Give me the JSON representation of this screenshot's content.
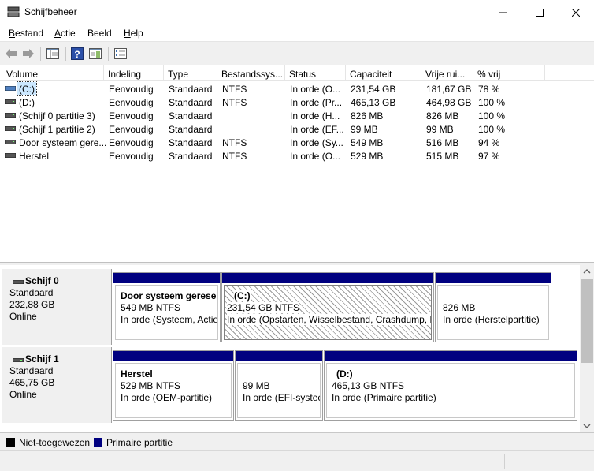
{
  "window": {
    "title": "Schijfbeheer"
  },
  "menu": {
    "items": [
      {
        "label": "Bestand",
        "underline": "B",
        "rest": "estand"
      },
      {
        "label": "Actie",
        "underline": "A",
        "rest": "ctie"
      },
      {
        "label": "Beeld",
        "underline": "",
        "rest": "Beeld"
      },
      {
        "label": "Help",
        "underline": "H",
        "rest": "elp"
      }
    ]
  },
  "list": {
    "columns": [
      "Volume",
      "Indeling",
      "Type",
      "Bestandssys...",
      "Status",
      "Capaciteit",
      "Vrije rui...",
      "% vrij"
    ],
    "rows": [
      {
        "volume": "(C:)",
        "indeling": "Eenvoudig",
        "type": "Standaard",
        "fs": "NTFS",
        "status": "In orde (O...",
        "capaciteit": "231,54 GB",
        "vrij": "181,67 GB",
        "pct": "78 %"
      },
      {
        "volume": "(D:)",
        "indeling": "Eenvoudig",
        "type": "Standaard",
        "fs": "NTFS",
        "status": "In orde (Pr...",
        "capaciteit": "465,13 GB",
        "vrij": "464,98 GB",
        "pct": "100 %"
      },
      {
        "volume": "(Schijf 0 partitie 3)",
        "indeling": "Eenvoudig",
        "type": "Standaard",
        "fs": "",
        "status": "In orde (H...",
        "capaciteit": "826 MB",
        "vrij": "826 MB",
        "pct": "100 %"
      },
      {
        "volume": "(Schijf 1 partitie 2)",
        "indeling": "Eenvoudig",
        "type": "Standaard",
        "fs": "",
        "status": "In orde (EF...",
        "capaciteit": "99 MB",
        "vrij": "99 MB",
        "pct": "100 %"
      },
      {
        "volume": "Door systeem gere...",
        "indeling": "Eenvoudig",
        "type": "Standaard",
        "fs": "NTFS",
        "status": "In orde (Sy...",
        "capaciteit": "549 MB",
        "vrij": "516 MB",
        "pct": "94 %"
      },
      {
        "volume": "Herstel",
        "indeling": "Eenvoudig",
        "type": "Standaard",
        "fs": "NTFS",
        "status": "In orde (O...",
        "capaciteit": "529 MB",
        "vrij": "515 MB",
        "pct": "97 %"
      }
    ]
  },
  "disks": [
    {
      "name": "Schijf 0",
      "kind": "Standaard",
      "size": "232,88 GB",
      "state": "Online",
      "partitions": [
        {
          "name": "Door systeem gereser",
          "size": "549 MB NTFS",
          "status": "In orde (Systeem, Actie"
        },
        {
          "name": "(C:)",
          "size": "231,54 GB NTFS",
          "status": "In orde (Opstarten, Wisselbestand, Crashdump, P"
        },
        {
          "name": "",
          "size": "826 MB",
          "status": "In orde (Herstelpartitie)"
        }
      ]
    },
    {
      "name": "Schijf 1",
      "kind": "Standaard",
      "size": "465,75 GB",
      "state": "Online",
      "partitions": [
        {
          "name": "Herstel",
          "size": "529 MB NTFS",
          "status": "In orde (OEM-partitie)"
        },
        {
          "name": "",
          "size": "99 MB",
          "status": "In orde (EFI-systee"
        },
        {
          "name": "(D:)",
          "size": "465,13 GB NTFS",
          "status": "In orde (Primaire partitie)"
        }
      ]
    }
  ],
  "legend": [
    {
      "label": "Niet-toegewezen",
      "color": "#000000"
    },
    {
      "label": "Primaire partitie",
      "color": "#000080"
    }
  ],
  "colors": {
    "primary_bar": "#000080",
    "selection": "#cce8ff"
  }
}
